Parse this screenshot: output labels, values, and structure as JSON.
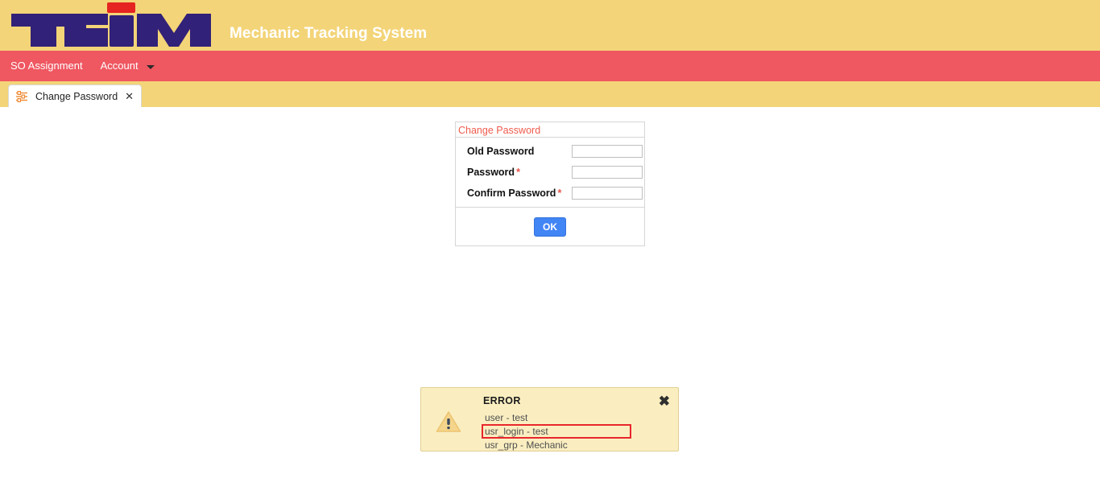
{
  "header": {
    "logo_text": "TEIM",
    "logo_color": "#322178",
    "logo_accent_color": "#e52421",
    "app_title": "Mechanic Tracking System",
    "background_color": "#f3d478"
  },
  "nav": {
    "background_color": "#ef5761",
    "items": [
      {
        "label": "SO Assignment",
        "has_caret": false
      },
      {
        "label": "Account",
        "has_caret": true
      }
    ]
  },
  "tabs": [
    {
      "label": "Change Password",
      "icon": "sliders-icon",
      "close_label": "✕",
      "active": true
    }
  ],
  "panel": {
    "title": "Change Password",
    "title_color": "#ef5b4c",
    "fields": [
      {
        "label": "Old Password",
        "required": false,
        "value": "",
        "placeholder": ""
      },
      {
        "label": "Password",
        "required": true,
        "value": "",
        "placeholder": ""
      },
      {
        "label": "Confirm Password",
        "required": true,
        "value": "",
        "placeholder": ""
      }
    ],
    "required_marker": "*",
    "submit_label": "OK",
    "submit_color": "#4285f4"
  },
  "error_box": {
    "title": "ERROR",
    "icon": "warning-triangle-icon",
    "close_label": "✖",
    "background_color": "#faeec1",
    "border_color": "#e2cf93",
    "highlight_color": "#e8262b",
    "lines": [
      {
        "text": "user - test",
        "highlighted": false
      },
      {
        "text": "usr_login - test",
        "highlighted": true
      },
      {
        "text": "usr_grp - Mechanic",
        "highlighted": false
      }
    ]
  }
}
